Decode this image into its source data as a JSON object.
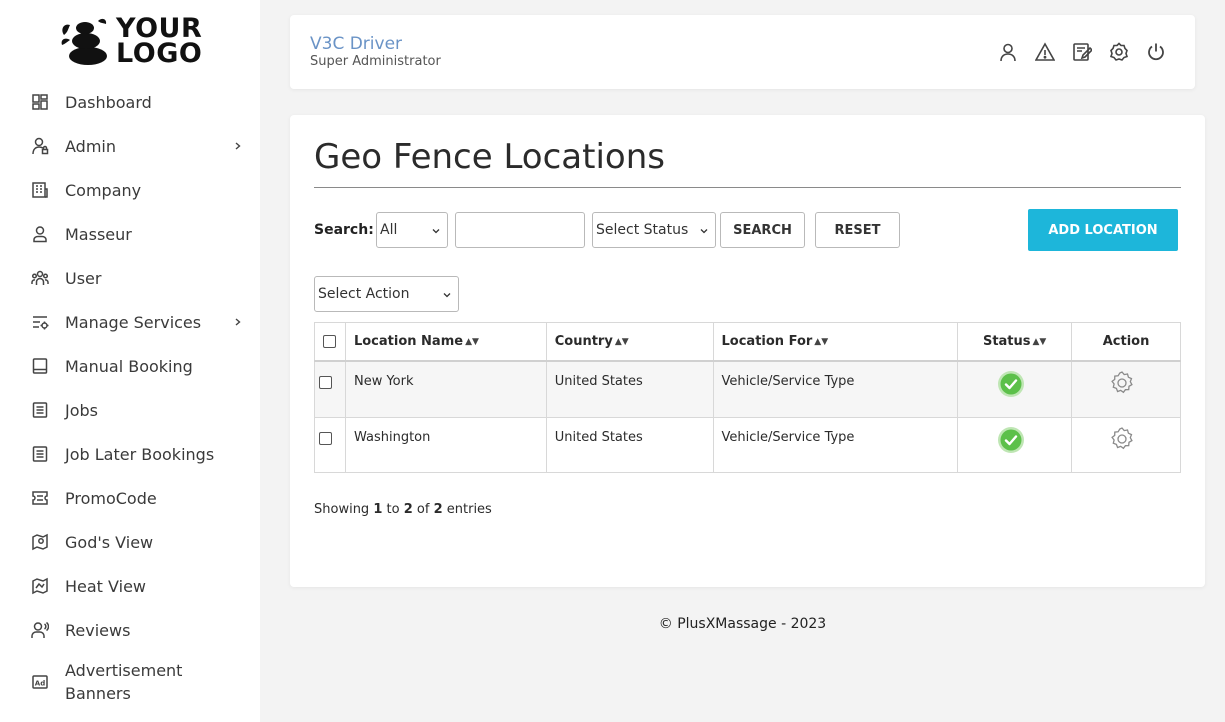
{
  "logo": {
    "line1": "YOUR",
    "line2": "LOGO"
  },
  "sidebar": {
    "items": [
      {
        "label": "Dashboard",
        "icon": "dashboard-icon"
      },
      {
        "label": "Admin",
        "icon": "admin-icon",
        "has_submenu": true
      },
      {
        "label": "Company",
        "icon": "company-icon"
      },
      {
        "label": "Masseur",
        "icon": "masseur-icon"
      },
      {
        "label": "User",
        "icon": "users-icon"
      },
      {
        "label": "Manage Services",
        "icon": "manage-services-icon",
        "has_submenu": true
      },
      {
        "label": "Manual Booking",
        "icon": "manual-booking-icon"
      },
      {
        "label": "Jobs",
        "icon": "jobs-icon"
      },
      {
        "label": "Job Later Bookings",
        "icon": "job-later-icon"
      },
      {
        "label": "PromoCode",
        "icon": "promocode-icon"
      },
      {
        "label": "God's View",
        "icon": "gods-view-icon"
      },
      {
        "label": "Heat View",
        "icon": "heat-view-icon"
      },
      {
        "label": "Reviews",
        "icon": "reviews-icon"
      },
      {
        "label": "Advertisement Banners",
        "icon": "ad-icon"
      }
    ]
  },
  "header": {
    "title": "V3C Driver",
    "subtitle": "Super Administrator",
    "icons": [
      "profile-icon",
      "alert-icon",
      "edit-icon",
      "settings-icon",
      "power-icon"
    ]
  },
  "page": {
    "title": "Geo Fence Locations",
    "search_label": "Search:",
    "search_filter_value": "All",
    "search_input_value": "",
    "status_select_value": "Select Status",
    "search_button": "SEARCH",
    "reset_button": "RESET",
    "add_button": "ADD LOCATION",
    "action_select_value": "Select Action"
  },
  "table": {
    "columns": [
      "Location Name",
      "Country",
      "Location For",
      "Status",
      "Action"
    ],
    "rows": [
      {
        "name": "New York",
        "country": "United States",
        "location_for": "Vehicle/Service Type",
        "status": "active"
      },
      {
        "name": "Washington",
        "country": "United States",
        "location_for": "Vehicle/Service Type",
        "status": "active"
      }
    ]
  },
  "pagination": {
    "prefix": "Showing",
    "from": "1",
    "to_word": "to",
    "to": "2",
    "of_word": "of",
    "total": "2",
    "suffix": "entries"
  },
  "footer": {
    "text": "© PlusXMassage - 2023"
  },
  "colors": {
    "accent": "#1db6da",
    "brand_title": "#6a93c6",
    "status_green": "#5cc04a"
  }
}
